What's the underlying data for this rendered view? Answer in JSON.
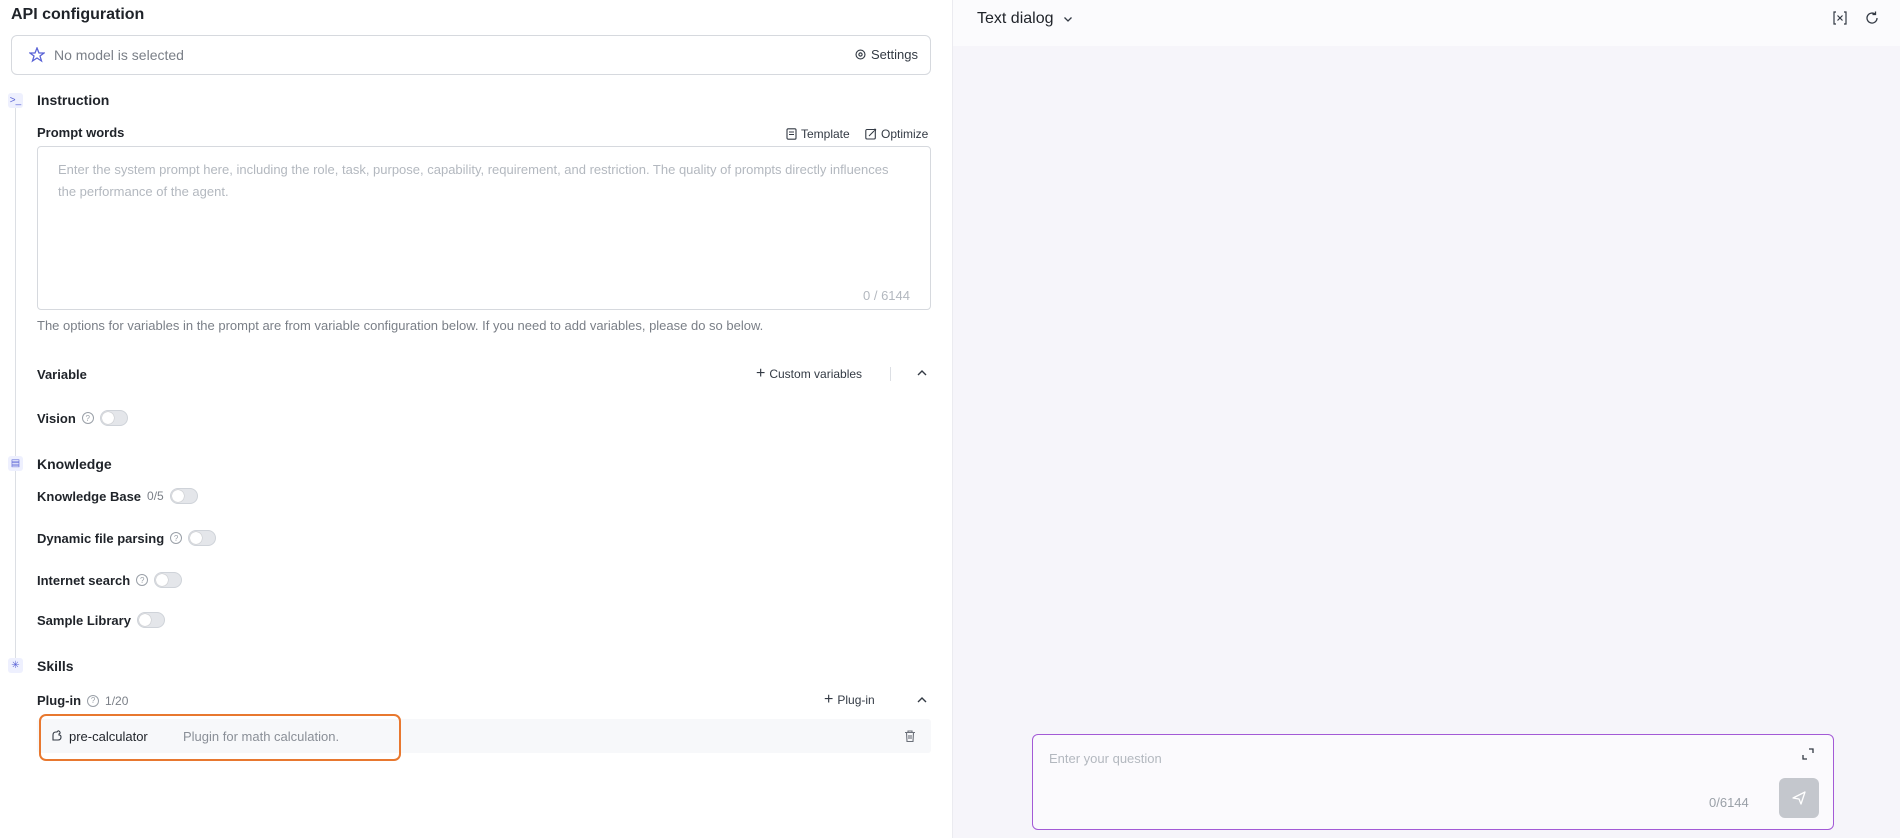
{
  "header": {
    "title": "API configuration"
  },
  "model": {
    "placeholder": "No model is selected",
    "settings_label": "Settings"
  },
  "instruction": {
    "section_title": "Instruction",
    "prompt_label": "Prompt words",
    "template_label": "Template",
    "optimize_label": "Optimize",
    "prompt_placeholder": "Enter the system prompt here, including the role, task, purpose, capability, requirement, and restriction. The quality of prompts directly influences the performance of the agent.",
    "prompt_count": "0 / 6144",
    "hint": "The options for variables in the prompt are from variable configuration below. If you need to add variables, please do so below.",
    "variable_label": "Variable",
    "custom_variables_label": "Custom variables",
    "vision_label": "Vision",
    "vision_enabled": false
  },
  "knowledge": {
    "section_title": "Knowledge",
    "items": [
      {
        "label": "Knowledge Base",
        "count": "0/5",
        "enabled": false
      },
      {
        "label": "Dynamic file parsing",
        "enabled": false
      },
      {
        "label": "Internet search",
        "enabled": false
      },
      {
        "label": "Sample Library",
        "enabled": false
      }
    ]
  },
  "skills": {
    "section_title": "Skills",
    "plugin_label": "Plug-in",
    "plugin_count": "1/20",
    "add_plugin_label": "Plug-in",
    "plugins": [
      {
        "name": "pre-calculator",
        "description": "Plugin for math calculation."
      }
    ]
  },
  "dialog": {
    "title": "Text dialog",
    "input_placeholder": "Enter your question",
    "input_count": "0/6144"
  },
  "colors": {
    "accent": "#5a63d6",
    "highlight": "#e8782f",
    "chat_border": "#a35ad6"
  }
}
